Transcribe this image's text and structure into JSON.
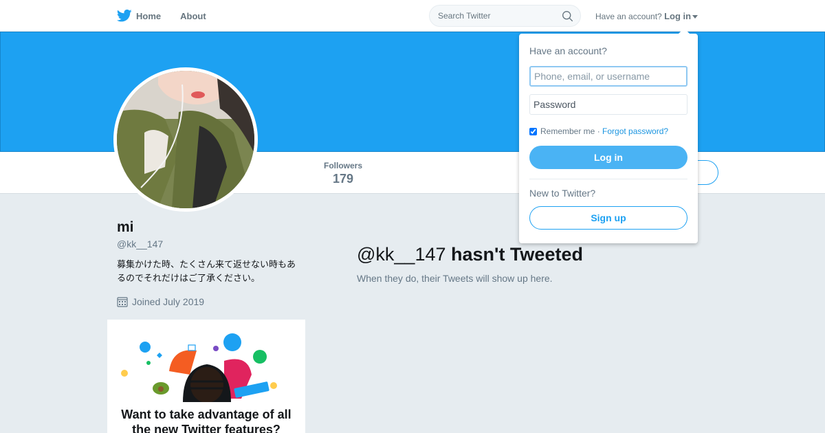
{
  "nav": {
    "home_label": "Home",
    "about_label": "About",
    "search_placeholder": "Search Twitter",
    "account_prompt": "Have an account?",
    "login_label": "Log in"
  },
  "profile": {
    "name": "mi",
    "handle": "@kk__147",
    "bio": "募集かけた時、たくさん来て返せない時もあるのでそれだけはご了承ください。",
    "joined": "Joined July 2019",
    "followers_label": "Followers",
    "followers_count": "179"
  },
  "timeline": {
    "empty_handle": "@kk__147",
    "empty_title_rest": " hasn't Tweeted",
    "empty_subtitle": "When they do, their Tweets will show up here."
  },
  "promo": {
    "title": "Want to take advantage of all the new Twitter features?"
  },
  "login_dropdown": {
    "heading": "Have an account?",
    "username_placeholder": "Phone, email, or username",
    "password_placeholder": "Password",
    "remember_label": "Remember me",
    "separator": " · ",
    "forgot_label": "Forgot password?",
    "login_button": "Log in",
    "new_prompt": "New to Twitter?",
    "signup_button": "Sign up"
  },
  "colors": {
    "brand": "#1da1f2",
    "login_button": "#4ab3f4",
    "page_bg": "#e6ecf0"
  }
}
